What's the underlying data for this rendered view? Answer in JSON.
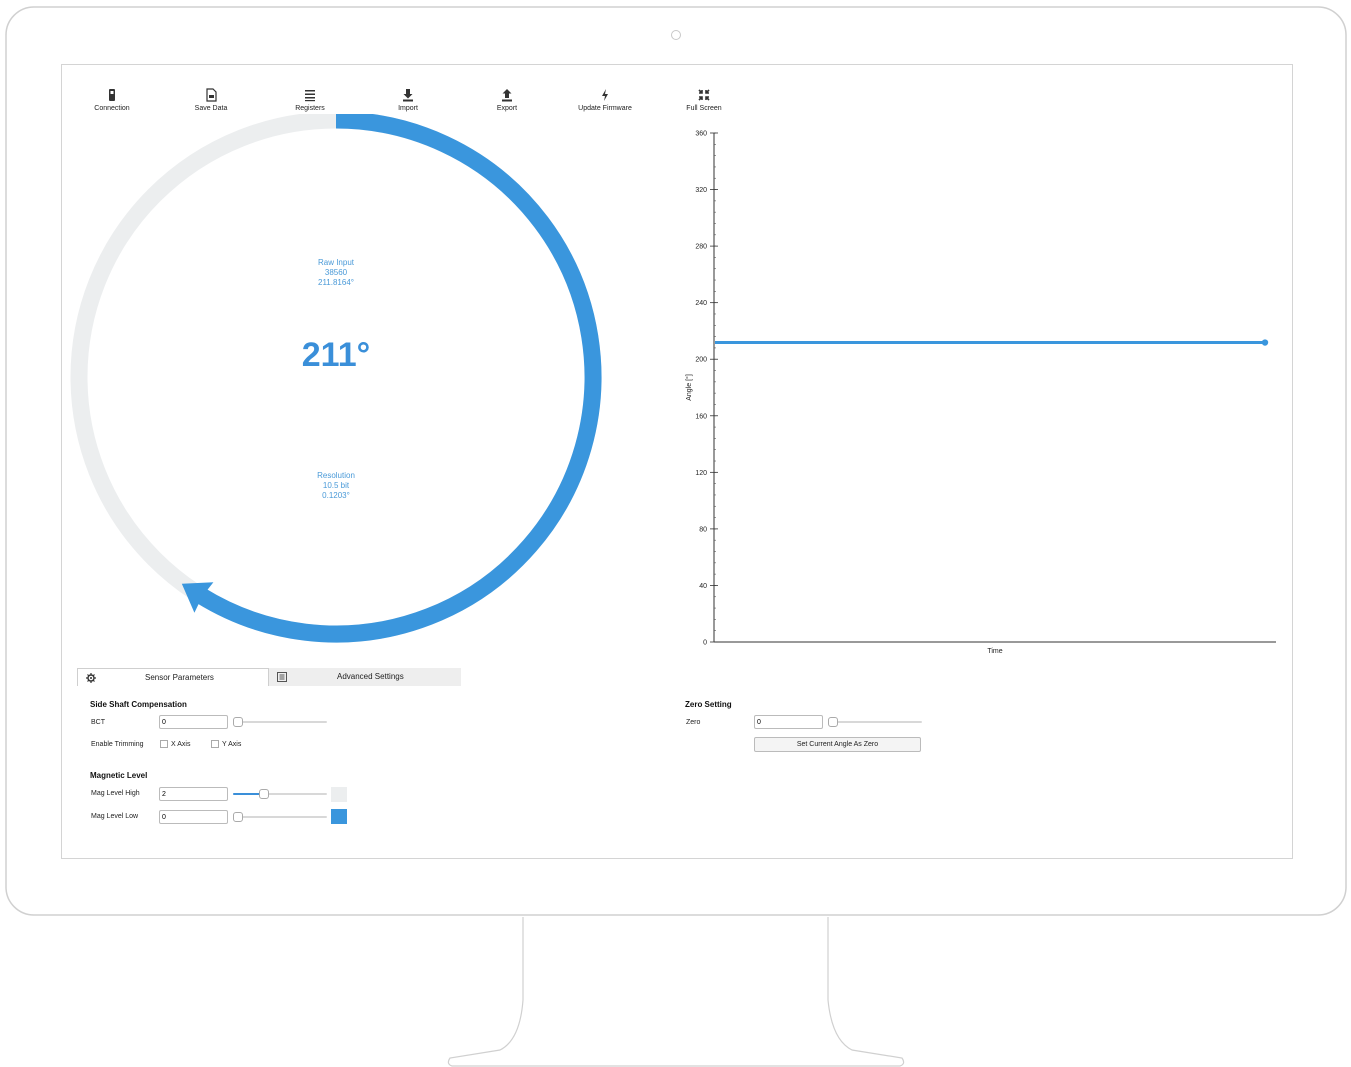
{
  "toolbar": {
    "connection": "Connection",
    "save_data": "Save Data",
    "registers": "Registers",
    "import": "Import",
    "export": "Export",
    "update_firmware": "Update Firmware",
    "full_screen": "Full Screen"
  },
  "gauge": {
    "angle_deg": 211.8164,
    "angle_display": "211°",
    "raw_input_label": "Raw Input",
    "raw_input_value": "38560",
    "raw_input_angle": "211.8164°",
    "resolution_label": "Resolution",
    "resolution_bits": "10.5 bit",
    "resolution_deg": "0.1203°",
    "accent_color": "#3a96dd",
    "track_color": "#eceeef"
  },
  "chart_data": {
    "type": "line",
    "title": "",
    "xlabel": "Time",
    "ylabel": "Angle [°]",
    "ylim": [
      0,
      360
    ],
    "yticks": [
      "0",
      "40",
      "80",
      "120",
      "160",
      "200",
      "240",
      "280",
      "320",
      "360"
    ],
    "series": [
      {
        "values": [
          211.8,
          211.8,
          211.8,
          211.8,
          211.8
        ]
      }
    ],
    "color": "#3a96dd"
  },
  "tabs": [
    {
      "label": "Sensor Parameters",
      "icon": "gear-icon",
      "active": true
    },
    {
      "label": "Advanced Settings",
      "icon": "list-icon",
      "active": false
    }
  ],
  "side_shaft": {
    "title": "Side Shaft Compensation",
    "bct_label": "BCT",
    "bct_value": "0",
    "trim_label": "Enable Trimming",
    "x_axis": "X Axis",
    "y_axis": "Y Axis"
  },
  "magnetic": {
    "title": "Magnetic Level",
    "high_label": "Mag Level High",
    "high_value": "2",
    "high_fraction": 0.3,
    "low_label": "Mag Level Low",
    "low_value": "0",
    "high_swatch_color": "#eceeef",
    "low_swatch_color": "#3a96dd"
  },
  "zero": {
    "title": "Zero Setting",
    "zero_label": "Zero",
    "zero_value": "0",
    "button_label": "Set Current Angle As Zero"
  }
}
